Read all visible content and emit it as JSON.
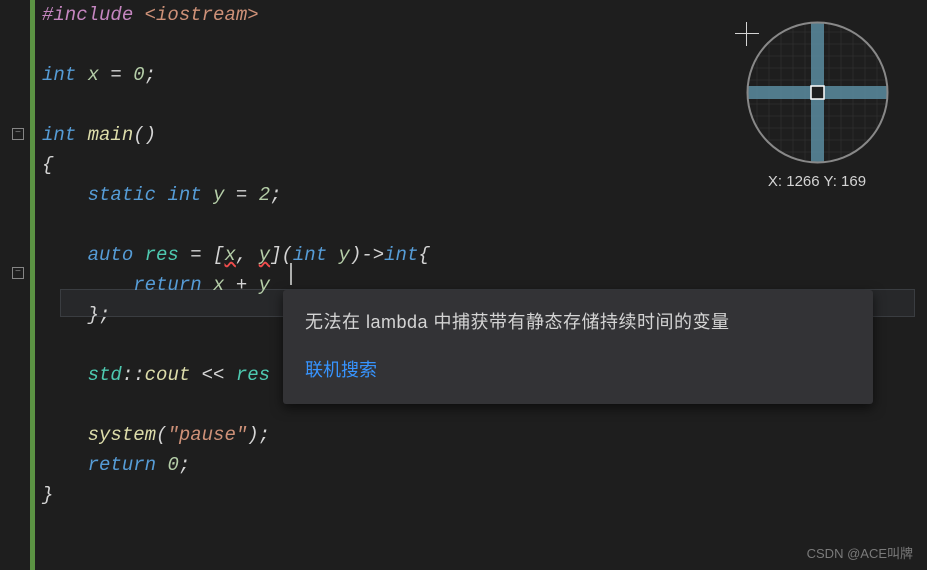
{
  "code": {
    "l1_include": "#include",
    "l1_header": "<iostream>",
    "l3_kw_int": "int",
    "l3_var_x": "x",
    "l3_eq": " = ",
    "l3_num": "0",
    "l3_semi": ";",
    "l5_kw_int": "int",
    "l5_main": "main",
    "l5_paren": "()",
    "l6_brace": "{",
    "l7_static": "static",
    "l7_int": "int",
    "l7_y": "y",
    "l7_eq": " = ",
    "l7_num": "2",
    "l7_semi": ";",
    "l9_auto": "auto",
    "l9_res": "res",
    "l9_eq": " = ",
    "l9_cap_open": "[",
    "l9_x": "x",
    "l9_comma": ", ",
    "l9_y_err": "y",
    "l9_cap_close": "]",
    "l9_paren_open": "(",
    "l9_int": "int",
    "l9_param_y": "y",
    "l9_paren_close": ")",
    "l9_arrow": "->",
    "l9_ret_int": "int",
    "l9_brace": "{",
    "l10_return": "return",
    "l10_x": "x",
    "l10_plus": " + ",
    "l10_y": "y",
    "l11_close": "};",
    "l13_std": "std",
    "l13_scope": "::",
    "l13_cout": "cout",
    "l13_op": " << ",
    "l13_res": "res",
    "l15_system": "system",
    "l15_paren_open": "(",
    "l15_str": "\"pause\"",
    "l15_paren_close": ")",
    "l15_semi": ";",
    "l16_return": "return",
    "l16_num": "0",
    "l16_semi": ";",
    "l17_brace": "}"
  },
  "tooltip": {
    "message": "无法在 lambda 中捕获带有静态存储持续时间的变量",
    "link": "联机搜索"
  },
  "magnifier": {
    "coord_label_x": "X: ",
    "coord_x": "1266",
    "coord_label_y": " Y: ",
    "coord_y": "169"
  },
  "fold": {
    "minus": "−"
  },
  "watermark": "CSDN @ACE叫牌"
}
